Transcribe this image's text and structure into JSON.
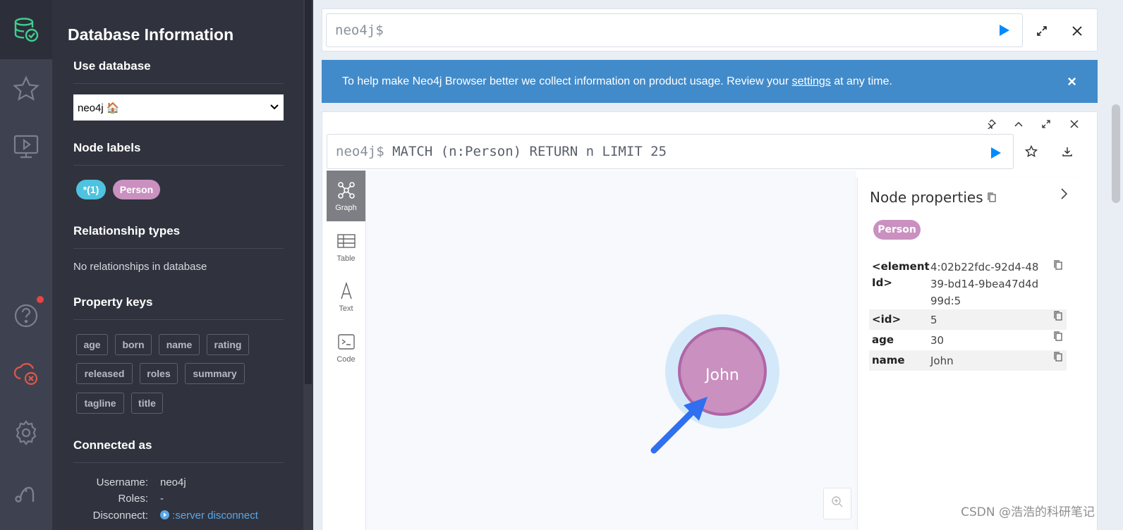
{
  "sidebar": {
    "title": "Database Information",
    "use_database_title": "Use database",
    "database_selected": "neo4j 🏠",
    "node_labels_title": "Node labels",
    "node_labels": [
      "*(1)",
      "Person"
    ],
    "relationship_types_title": "Relationship types",
    "relationship_types_empty": "No relationships in database",
    "property_keys_title": "Property keys",
    "property_keys": [
      "age",
      "born",
      "name",
      "rating",
      "released",
      "roles",
      "summary",
      "tagline",
      "title"
    ],
    "connected_as_title": "Connected as",
    "username_label": "Username:",
    "username_value": "neo4j",
    "roles_label": "Roles:",
    "roles_value": "-",
    "disconnect_label": "Disconnect:",
    "disconnect_value": ":server disconnect"
  },
  "rail_icons": [
    "database-icon",
    "star-icon",
    "monitor-play-icon",
    "help-icon",
    "cloud-error-icon",
    "gear-icon",
    "neo4j-logo-icon"
  ],
  "editor": {
    "prompt": "neo4j$"
  },
  "banner": {
    "text_before": "To help make Neo4j Browser better we collect information on product usage. Review your ",
    "link": "settings",
    "text_after": " at any time.",
    "close": "×"
  },
  "frame": {
    "prompt": "neo4j$",
    "query": "MATCH (n:Person) RETURN n LIMIT 25",
    "tabs": [
      "Graph",
      "Table",
      "Text",
      "Code"
    ],
    "node_caption": "John"
  },
  "node_properties": {
    "title": "Node properties",
    "label": "Person",
    "rows": [
      {
        "key": "<element Id>",
        "value": "4:02b22fdc-92d4-4839-bd14-9bea47d4d99d:5"
      },
      {
        "key": "<id>",
        "value": "5"
      },
      {
        "key": "age",
        "value": "30"
      },
      {
        "key": "name",
        "value": "John"
      }
    ]
  },
  "colors": {
    "accent_blue": "#428bca",
    "run_blue": "#018bff",
    "person_pink": "#c990c0",
    "all_nodes_cyan": "#4ec3e0"
  },
  "watermark": "CSDN @浩浩的科研笔记"
}
